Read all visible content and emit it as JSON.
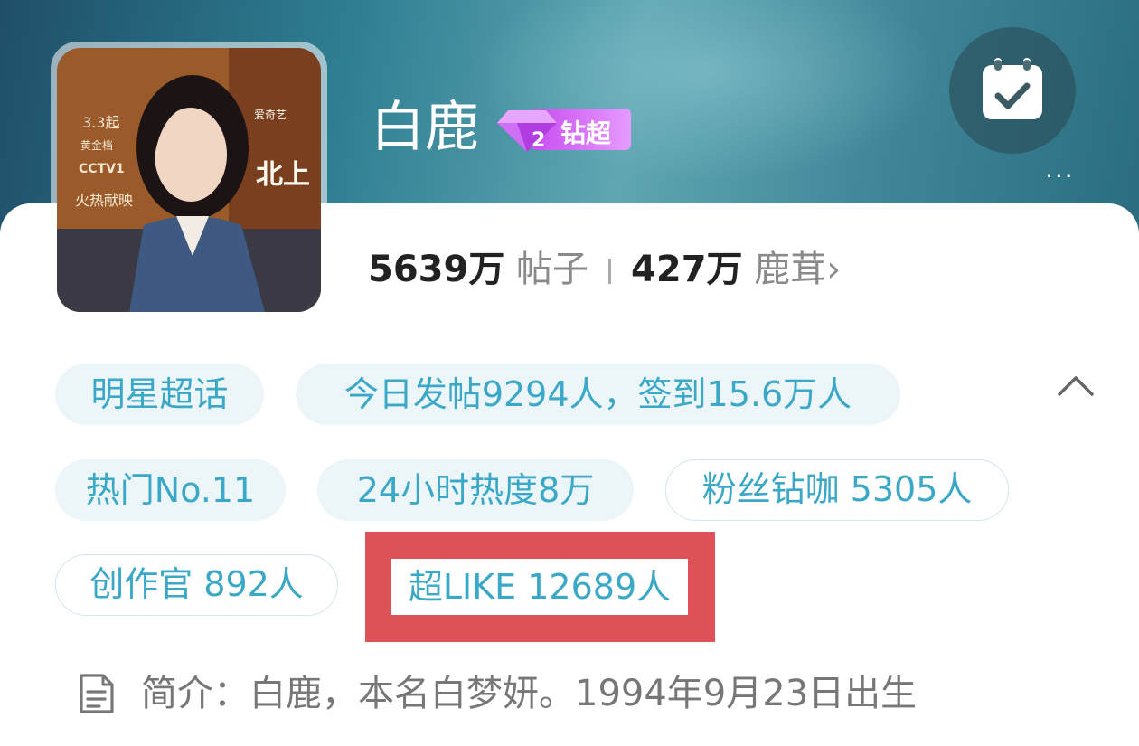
{
  "topic": {
    "name": "白鹿",
    "badge_label": "钻超",
    "badge_level": "2",
    "poster_texts": [
      "3.3起",
      "黄金档",
      "CCTV1",
      "火热献映",
      "北上",
      "爱奇艺"
    ]
  },
  "stats": {
    "posts_value": "5639万",
    "posts_label": "帖子",
    "fans_value": "427万",
    "fans_label": "鹿茸",
    "fans_arrow": "›"
  },
  "tags": [
    {
      "label": "明星超话"
    },
    {
      "label": "今日发帖9294人，签到15.6万人"
    },
    {
      "label": "热门No.11"
    },
    {
      "label": "24小时热度8万"
    },
    {
      "label": "粉丝钻咖 5305人"
    },
    {
      "label": "创作官 892人"
    },
    {
      "label": "超LIKE 12689人"
    }
  ],
  "intro": {
    "text": "简介：白鹿，本名白梦妍。1994年9月23日出生"
  },
  "more_icon": "···",
  "icons": [
    "calendar-check-icon",
    "more-icon",
    "chevron-up-icon",
    "document-icon",
    "diamond-icon"
  ],
  "colors": {
    "accent": "#3aa8c6",
    "highlight_box": "#dd5158",
    "badge": "#c94cf0"
  }
}
